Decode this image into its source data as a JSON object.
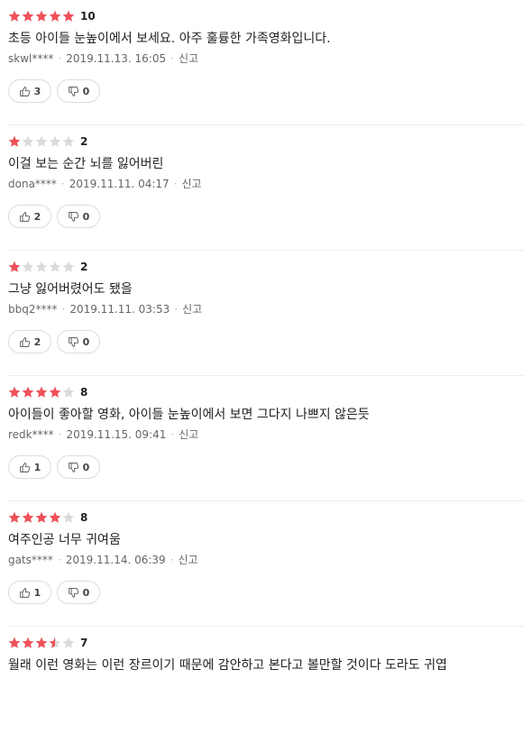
{
  "colors": {
    "star_filled": "#f0505a",
    "star_empty": "#dadada"
  },
  "reviews": [
    {
      "rating": 5.0,
      "score": "10",
      "comment": "초등 아이들 눈높이에서 보세요. 아주 훌륭한 가족영화입니다.",
      "user": "skwl****",
      "datetime": "2019.11.13. 16:05",
      "report_label": "신고",
      "likes": "3",
      "dislikes": "0"
    },
    {
      "rating": 1.0,
      "score": "2",
      "comment": "이걸 보는 순간 뇌를 잃어버린",
      "user": "dona****",
      "datetime": "2019.11.11. 04:17",
      "report_label": "신고",
      "likes": "2",
      "dislikes": "0"
    },
    {
      "rating": 1.0,
      "score": "2",
      "comment": "그냥 잃어버렸어도 됐을",
      "user": "bbq2****",
      "datetime": "2019.11.11. 03:53",
      "report_label": "신고",
      "likes": "2",
      "dislikes": "0"
    },
    {
      "rating": 4.0,
      "score": "8",
      "comment": "아이들이 좋아할 영화, 아이들 눈높이에서 보면 그다지 나쁘지 않은듯",
      "user": "redk****",
      "datetime": "2019.11.15. 09:41",
      "report_label": "신고",
      "likes": "1",
      "dislikes": "0"
    },
    {
      "rating": 4.0,
      "score": "8",
      "comment": "여주인공 너무 귀여움",
      "user": "gats****",
      "datetime": "2019.11.14. 06:39",
      "report_label": "신고",
      "likes": "1",
      "dislikes": "0"
    },
    {
      "rating": 3.5,
      "score": "7",
      "comment": "월래 이런 영화는 이런 장르이기 때문에 감안하고 본다고 볼만할 것이다 도라도 귀엽",
      "user": "",
      "datetime": "",
      "report_label": "",
      "likes": "",
      "dislikes": ""
    }
  ]
}
